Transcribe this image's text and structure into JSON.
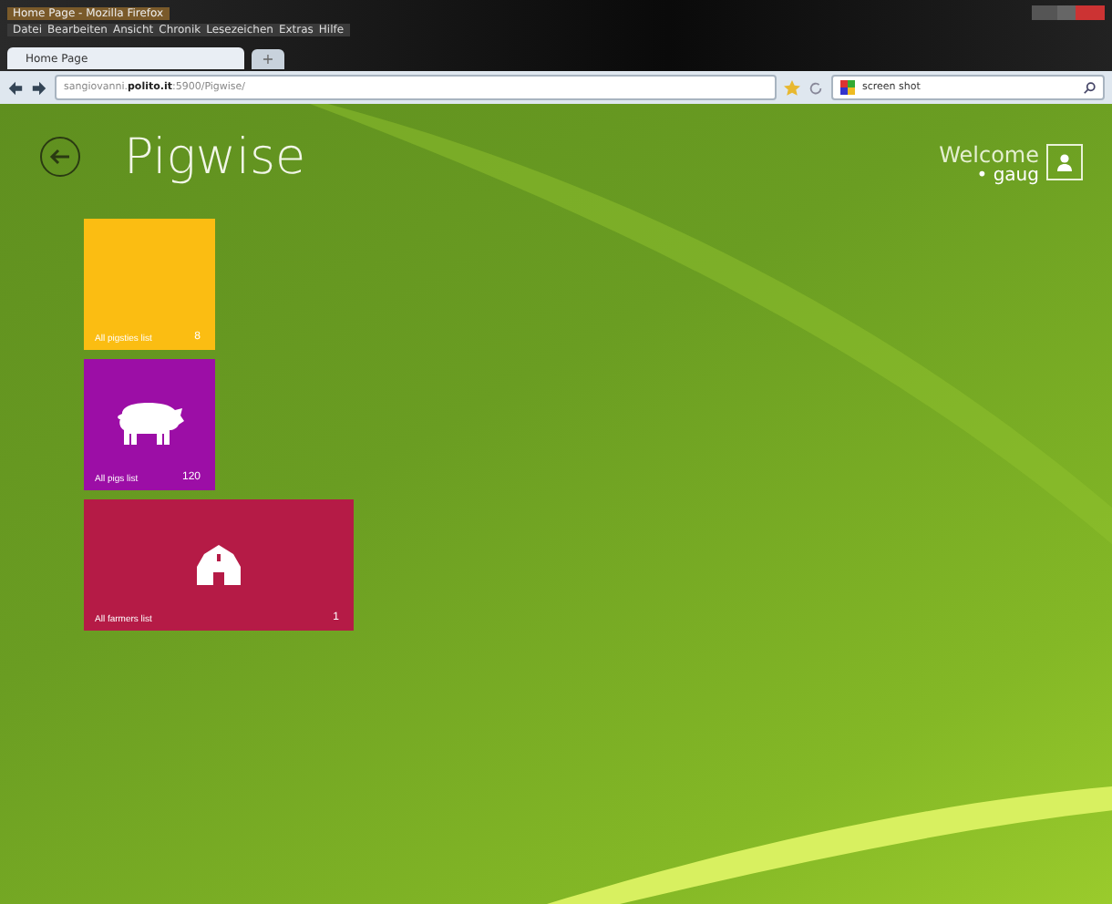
{
  "window": {
    "title": "Home Page - Mozilla Firefox"
  },
  "menu": [
    "Datei",
    "Bearbeiten",
    "Ansicht",
    "Chronik",
    "Lesezeichen",
    "Extras",
    "Hilfe"
  ],
  "tabs": [
    {
      "label": "Home Page",
      "selected": true
    }
  ],
  "new_tab": "+",
  "address_bar": {
    "value": "sangiovanni.**polito.it**:5900/Pigwise/"
  },
  "search": {
    "value": "screen shot"
  },
  "app": {
    "title": "Pigwise",
    "welcome": "Welcome",
    "user": "• gaug"
  },
  "tiles": [
    {
      "label": "All pigsties list",
      "count": "8",
      "color": "#fbbd12",
      "kind": "plain",
      "wide": false
    },
    {
      "label": "All pigs list",
      "count": "120",
      "color": "#9c0ea6",
      "kind": "pig",
      "wide": false
    },
    {
      "label": "All farmers list",
      "count": "1",
      "color": "#b51b46",
      "kind": "barn",
      "wide": true
    }
  ]
}
